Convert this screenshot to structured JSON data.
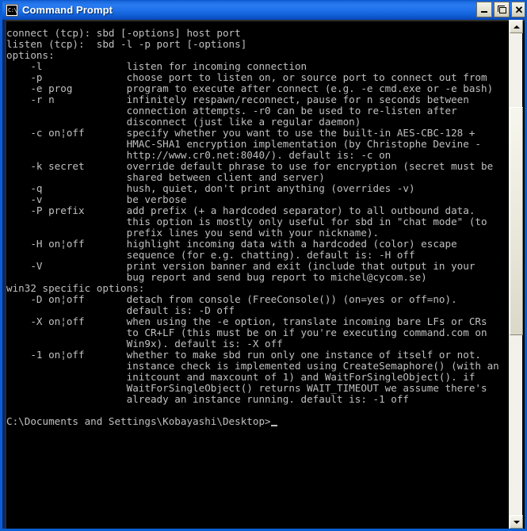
{
  "window": {
    "title": "Command Prompt",
    "icon": "command-prompt-icon",
    "icon_glyph": "C:\\",
    "buttons": {
      "minimize": "Minimize",
      "maximize": "Maximize",
      "close": "Close"
    }
  },
  "scrollbar": {
    "up_arrow": "scroll-up-arrow",
    "down_arrow": "scroll-down-arrow",
    "thumb": "scroll-thumb"
  },
  "console": {
    "lines": [
      "connect (tcp): sbd [-options] host port",
      "listen (tcp):  sbd -l -p port [-options]",
      "options:",
      "    -l              listen for incoming connection",
      "    -p              choose port to listen on, or source port to connect out from",
      "    -e prog         program to execute after connect (e.g. -e cmd.exe or -e bash)",
      "    -r n            infinitely respawn/reconnect, pause for n seconds between",
      "                    connection attempts. -r0 can be used to re-listen after",
      "                    disconnect (just like a regular daemon)",
      "    -c on¦off       specify whether you want to use the built-in AES-CBC-128 +",
      "                    HMAC-SHA1 encryption implementation (by Christophe Devine -",
      "                    http://www.cr0.net:8040/). default is: -c on",
      "    -k secret       override default phrase to use for encryption (secret must be",
      "                    shared between client and server)",
      "    -q              hush, quiet, don't print anything (overrides -v)",
      "    -v              be verbose",
      "    -P prefix       add prefix (+ a hardcoded separator) to all outbound data.",
      "                    this option is mostly only useful for sbd in \"chat mode\" (to",
      "                    prefix lines you send with your nickname).",
      "    -H on¦off       highlight incoming data with a hardcoded (color) escape",
      "                    sequence (for e.g. chatting). default is: -H off",
      "    -V              print version banner and exit (include that output in your",
      "                    bug report and send bug report to michel@cycom.se)",
      "win32 specific options:",
      "    -D on¦off       detach from console (FreeConsole()) (on=yes or off=no).",
      "                    default is: -D off",
      "    -X on¦off       when using the -e option, translate incoming bare LFs or CRs",
      "                    to CR+LF (this must be on if you're executing command.com on",
      "                    Win9x). default is: -X off",
      "    -1 on¦off       whether to make sbd run only one instance of itself or not.",
      "                    instance check is implemented using CreateSemaphore() (with an",
      "                    initcount and maxcount of 1) and WaitForSingleObject(). if",
      "                    WaitForSingleObject() returns WAIT_TIMEOUT we assume there's",
      "                    already an instance running. default is: -1 off",
      "",
      "C:\\Documents and Settings\\Kobayashi\\Desktop>"
    ],
    "prompt": "C:\\Documents and Settings\\Kobayashi\\Desktop>",
    "cursor": "block-cursor",
    "foreground_color": "#c0c0c0",
    "background_color": "#000000"
  },
  "colors": {
    "titlebar_accent": "#2a7bf0",
    "console_fg": "#c0c0c0",
    "console_bg": "#000000",
    "scrollbar_face": "#eae8db"
  }
}
